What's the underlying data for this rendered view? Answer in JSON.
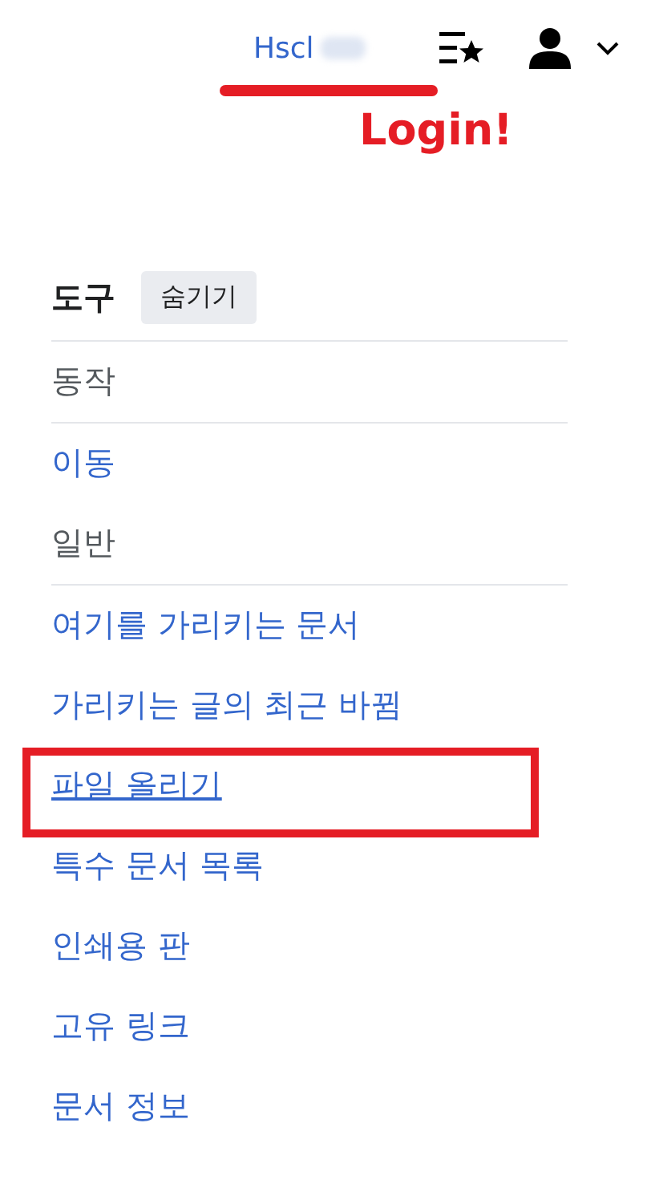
{
  "header": {
    "username": "Hscl",
    "username_redacted": true,
    "username_underlined": true,
    "annotation": "Login!"
  },
  "tools": {
    "title": "도구",
    "hide_button": "숨기기",
    "items": [
      {
        "kind": "divider"
      },
      {
        "kind": "label",
        "text": "동작"
      },
      {
        "kind": "divider"
      },
      {
        "kind": "link",
        "text": "이동",
        "highlighted": false
      },
      {
        "kind": "label",
        "text": "일반"
      },
      {
        "kind": "divider"
      },
      {
        "kind": "link",
        "text": "여기를 가리키는 문서",
        "highlighted": false
      },
      {
        "kind": "link",
        "text": "가리키는 글의 최근 바뀜",
        "highlighted": false
      },
      {
        "kind": "link",
        "text": "파일 올리기",
        "highlighted": true
      },
      {
        "kind": "link",
        "text": "특수 문서 목록",
        "highlighted": false
      },
      {
        "kind": "link",
        "text": "인쇄용 판",
        "highlighted": false
      },
      {
        "kind": "link",
        "text": "고유 링크",
        "highlighted": false
      },
      {
        "kind": "link",
        "text": "문서 정보",
        "highlighted": false
      }
    ]
  }
}
